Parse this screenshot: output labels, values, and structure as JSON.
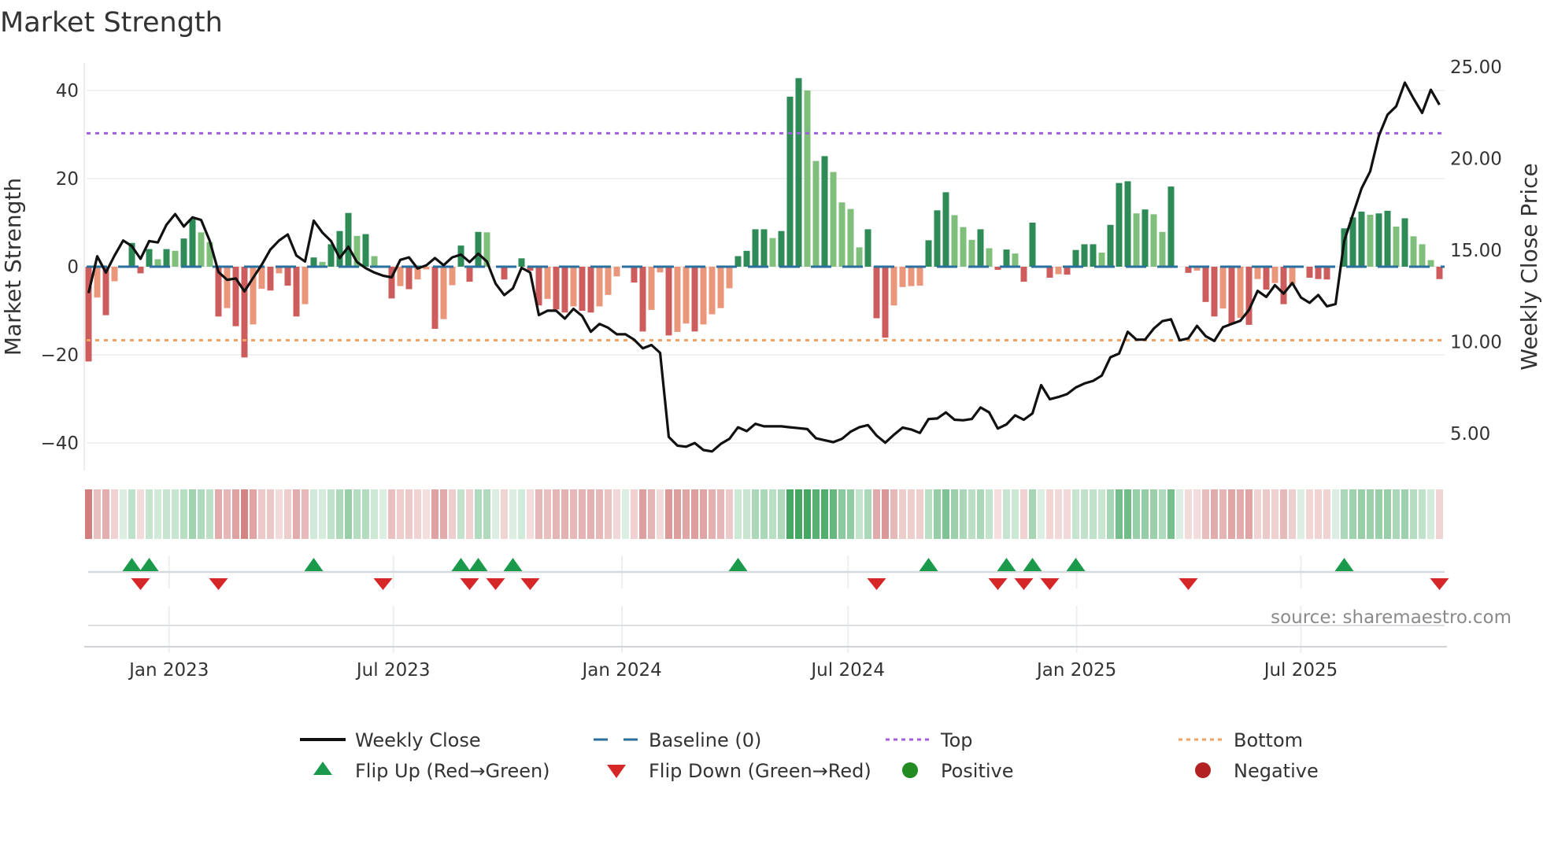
{
  "chart_data": {
    "type": "bar",
    "title": "Market Strength",
    "ylabel": "Market Strength",
    "y2label": "Weekly Close Price",
    "ylim": [
      -46,
      47
    ],
    "y2lim": [
      3.5,
      25.6
    ],
    "yticks": [
      "40",
      "20",
      "0",
      "−20",
      "−40"
    ],
    "ytick_values": [
      40,
      20,
      0,
      -20,
      -40
    ],
    "y2ticks": [
      "25.00",
      "20.00",
      "15.00",
      "10.00",
      "5.00"
    ],
    "y2tick_values": [
      25,
      20,
      15,
      10,
      5
    ],
    "xticks": [
      {
        "label": "Jan 2023",
        "week": 9.3
      },
      {
        "label": "Jul 2023",
        "week": 35.2
      },
      {
        "label": "Jan 2024",
        "week": 61.6
      },
      {
        "label": "Jul 2024",
        "week": 87.7
      },
      {
        "label": "Jan 2025",
        "week": 114.1
      },
      {
        "label": "Jul 2025",
        "week": 140.0
      }
    ],
    "top_level": 30.3,
    "bottom_level": -16.7,
    "baseline": 0,
    "strength": [
      -21.5,
      -7,
      -11,
      -3.3,
      0,
      5.4,
      -1.5,
      4,
      1.7,
      4,
      3.6,
      6.4,
      10.8,
      7.8,
      5.6,
      -11.3,
      -9.4,
      -13.5,
      -20.6,
      -13.1,
      -5,
      -5.4,
      -1.5,
      -4.3,
      -11.3,
      -8.5,
      2.1,
      1.1,
      5.1,
      8.1,
      12.2,
      7,
      7.4,
      2.4,
      0,
      -7.2,
      -4.4,
      -5.1,
      -2.9,
      -0.6,
      -14.1,
      -11.9,
      -4.2,
      4.8,
      -3.4,
      7.9,
      7.8,
      0,
      -2.9,
      0,
      1.9,
      -0.9,
      -8.8,
      -7.3,
      -9.7,
      -10.4,
      -9,
      -10,
      -10.4,
      -9,
      -6.4,
      -2.2,
      0,
      -3.6,
      -14.7,
      -9.8,
      -1.3,
      -15.6,
      -14.8,
      -12.9,
      -14.7,
      -13.1,
      -10.8,
      -9.4,
      -4.9,
      2.4,
      3.6,
      8.5,
      8.5,
      6.5,
      8.1,
      38.6,
      42.8,
      40,
      24,
      25.1,
      21.5,
      14.6,
      13.1,
      4.4,
      8.5,
      -11.7,
      -16.1,
      -8.8,
      -4.6,
      -4.4,
      -4.3,
      6,
      12.8,
      16.9,
      11.7,
      9,
      6.1,
      8.5,
      4.2,
      -0.7,
      3.9,
      3,
      -3.4,
      10,
      0,
      -2.5,
      -1.7,
      -1.8,
      3.8,
      5.1,
      5.1,
      3.2,
      9.5,
      19,
      19.4,
      12.1,
      13,
      11.9,
      7.9,
      18.2,
      0,
      -1.4,
      -0.9,
      -8,
      -11.3,
      -9.5,
      -13,
      -11.6,
      -13.2,
      -2.8,
      -5.2,
      -3.7,
      -8.5,
      -4,
      0,
      -2.5,
      -2.8,
      -2.9,
      0,
      8.7,
      11.2,
      12.5,
      11.8,
      12.1,
      12.7,
      9.1,
      11,
      6.9,
      5.1,
      1.5,
      -2.8
    ],
    "weekly_close": [
      12.66,
      14.67,
      13.78,
      14.71,
      15.53,
      15.22,
      14.53,
      15.5,
      15.42,
      16.39,
      16.97,
      16.29,
      16.79,
      16.65,
      15.5,
      13.81,
      13.38,
      13.46,
      12.75,
      13.49,
      14.21,
      15.04,
      15.53,
      15.86,
      14.71,
      14.38,
      16.61,
      15.96,
      15.5,
      14.57,
      15.19,
      14.35,
      14.02,
      13.78,
      13.61,
      13.52,
      14.47,
      14.61,
      14,
      14.17,
      14.57,
      14.18,
      14.61,
      14.76,
      14.35,
      14.81,
      14.38,
      13.18,
      12.55,
      12.92,
      14.04,
      13.78,
      11.46,
      11.7,
      11.7,
      11.27,
      11.8,
      11.41,
      10.55,
      10.98,
      10.77,
      10.41,
      10.41,
      10.12,
      9.65,
      9.83,
      9.4,
      4.81,
      4.34,
      4.28,
      4.48,
      4.1,
      4.02,
      4.43,
      4.71,
      5.34,
      5.13,
      5.53,
      5.39,
      5.39,
      5.39,
      5.34,
      5.29,
      5.24,
      4.74,
      4.63,
      4.53,
      4.71,
      5.1,
      5.34,
      5.46,
      4.89,
      4.5,
      4.93,
      5.32,
      5.22,
      5.03,
      5.79,
      5.82,
      6.15,
      5.75,
      5.72,
      5.79,
      6.42,
      6.15,
      5.27,
      5.5,
      5.99,
      5.75,
      6.1,
      7.64,
      6.87,
      6.99,
      7.15,
      7.51,
      7.73,
      7.87,
      8.16,
      9.16,
      9.36,
      10.55,
      10.12,
      10.12,
      10.72,
      11.13,
      11.23,
      10.08,
      10.19,
      10.87,
      10.31,
      10.05,
      10.8,
      10.98,
      11.15,
      11.74,
      12.78,
      12.45,
      13.09,
      12.63,
      13.21,
      12.42,
      12.13,
      12.56,
      11.94,
      12.06,
      15.5,
      16.94,
      18.37,
      19.3,
      21.24,
      22.39,
      22.85,
      24.14,
      23.28,
      22.49,
      23.75,
      22.93
    ],
    "flip_up_weeks": [
      5,
      7,
      26,
      43,
      45,
      49,
      75,
      97,
      106,
      109,
      114,
      145
    ],
    "flip_down_weeks": [
      6,
      15,
      34,
      44,
      47,
      51,
      91,
      105,
      108,
      111,
      127,
      156
    ],
    "legend": [
      {
        "label": "Weekly Close",
        "kind": "line"
      },
      {
        "label": "Baseline (0)",
        "kind": "dash"
      },
      {
        "label": "Top",
        "kind": "dot-purple"
      },
      {
        "label": "Bottom",
        "kind": "dot-orange"
      },
      {
        "label": "Flip Up (Red→Green)",
        "kind": "tri-up"
      },
      {
        "label": "Flip Down (Green→Red)",
        "kind": "tri-down"
      },
      {
        "label": "Positive",
        "kind": "dot-green"
      },
      {
        "label": "Negative",
        "kind": "dot-red"
      }
    ],
    "legend_placement": "bottom",
    "source": "source: sharemaestro.com",
    "colors": {
      "pos_up": "#2e8b57",
      "pos_down": "#7fbf7b",
      "neg_down": "#cd5c5c",
      "neg_up": "#e9967a",
      "close": "#111111",
      "baseline": "#2a6f9e",
      "top": "#a15ee0",
      "bottom": "#f2a262",
      "flip_up": "#1a9a4a",
      "flip_down": "#d62728",
      "positive": "#228b22",
      "negative": "#b22222",
      "strip_pos": "#3aa35a",
      "strip_neg": "#c65a5a"
    }
  }
}
